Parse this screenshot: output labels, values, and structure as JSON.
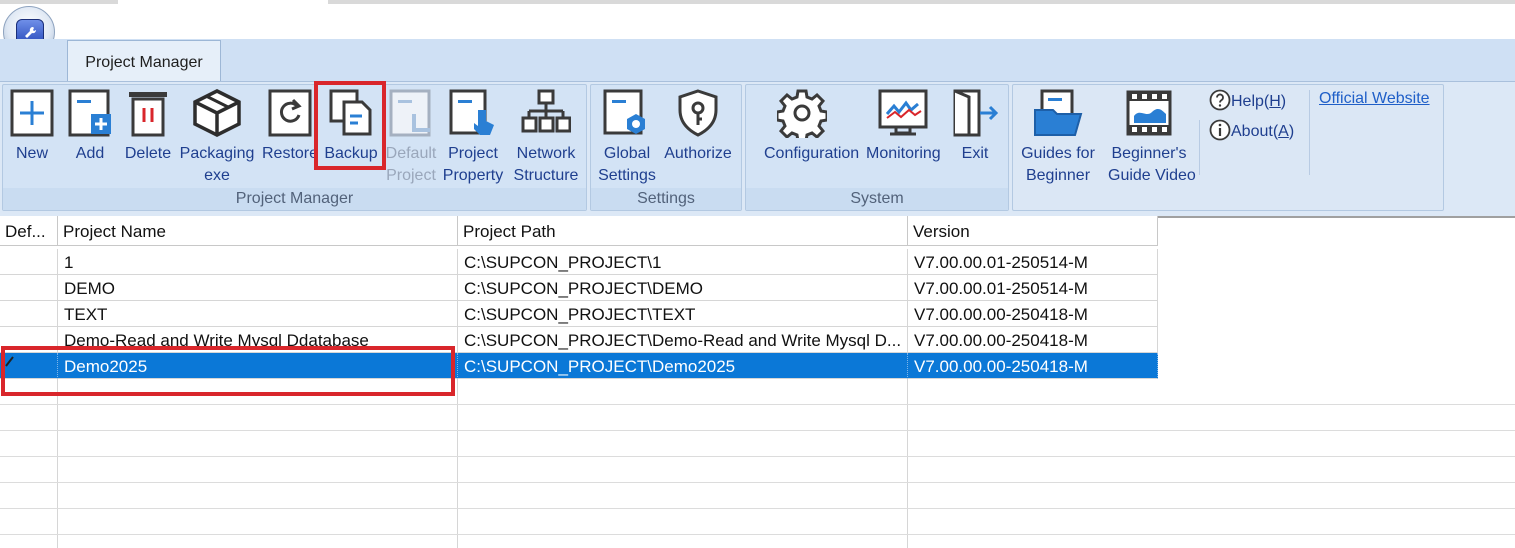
{
  "ribbon": {
    "tab_label": "Project Manager",
    "groups": {
      "project_manager": "Project Manager",
      "settings": "Settings",
      "system": "System"
    },
    "buttons": {
      "new": "New",
      "add": "Add",
      "delete": "Delete",
      "packaging_1": "Packaging",
      "packaging_2": "exe",
      "restore": "Restore",
      "backup": "Backup",
      "default_1": "Default",
      "default_2": "Project",
      "property_1": "Project",
      "property_2": "Property",
      "network_1": "Network",
      "network_2": "Structure",
      "global_1": "Global",
      "global_2": "Settings",
      "authorize": "Authorize",
      "configuration": "Configuration",
      "monitoring": "Monitoring",
      "exit": "Exit",
      "guides_1": "Guides for",
      "guides_2": "Beginner",
      "video_1": "Beginner's",
      "video_2": "Guide Video"
    },
    "help_prefix": "Help(",
    "help_key": "H",
    "help_suffix": ")",
    "about_prefix": "About(",
    "about_key": "A",
    "about_suffix": ")",
    "official_website": "Official Website"
  },
  "table": {
    "columns": [
      "Def...",
      "Project Name",
      "Project Path",
      "Version"
    ],
    "rows": [
      {
        "name": "1",
        "path": "C:\\SUPCON_PROJECT\\1",
        "version": "V7.00.00.01-250514-M"
      },
      {
        "name": "DEMO",
        "path": "C:\\SUPCON_PROJECT\\DEMO",
        "version": "V7.00.00.01-250514-M"
      },
      {
        "name": "TEXT",
        "path": "C:\\SUPCON_PROJECT\\TEXT",
        "version": "V7.00.00.00-250418-M"
      },
      {
        "name": "Demo-Read and Write Mysql Ddatabase",
        "path": "C:\\SUPCON_PROJECT\\Demo-Read and Write Mysql D...",
        "version": "V7.00.00.00-250418-M"
      },
      {
        "name": "Demo2025",
        "path": "C:\\SUPCON_PROJECT\\Demo2025",
        "version": "V7.00.00.00-250418-M"
      }
    ],
    "selected_index": 4
  },
  "colors": {
    "selection": "#0b78d7",
    "highlight_box": "#d9262b",
    "ribbon_text": "#1f3f8f"
  }
}
